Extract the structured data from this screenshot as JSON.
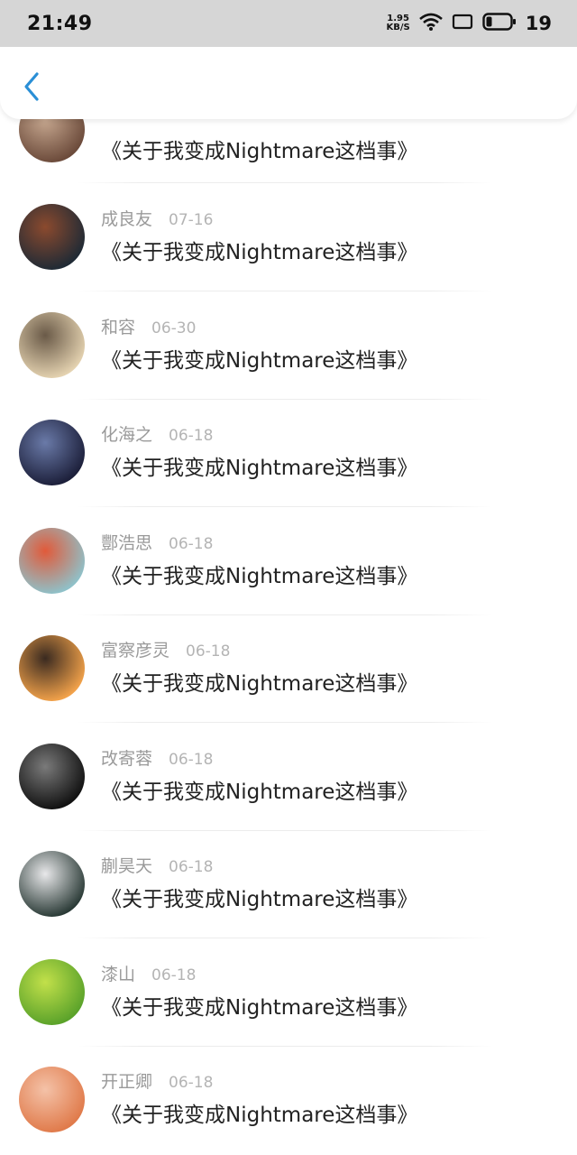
{
  "status_bar": {
    "time": "21:49",
    "net_speed_value": "1.95",
    "net_speed_unit": "KB/S",
    "battery_level": "19",
    "icons": [
      "wifi-icon",
      "screen-icon",
      "battery-icon"
    ]
  },
  "nav": {
    "back_icon": "chevron-left-icon",
    "accent": "#2a8fd6"
  },
  "items": [
    {
      "name": "",
      "date": "",
      "title": "《关于我变成Nightmare这档事》",
      "avatar_colors": [
        "#6b4a3a",
        "#c7a890"
      ]
    },
    {
      "name": "成良友",
      "date": "07-16",
      "title": "《关于我变成Nightmare这档事》",
      "avatar_colors": [
        "#1f2a35",
        "#8b4a2e"
      ]
    },
    {
      "name": "和容",
      "date": "06-30",
      "title": "《关于我变成Nightmare这档事》",
      "avatar_colors": [
        "#e4d2b0",
        "#6a5a48"
      ]
    },
    {
      "name": "化海之",
      "date": "06-18",
      "title": "《关于我变成Nightmare这档事》",
      "avatar_colors": [
        "#1c1f3a",
        "#6a7aa8"
      ]
    },
    {
      "name": "酆浩思",
      "date": "06-18",
      "title": "《关于我变成Nightmare这档事》",
      "avatar_colors": [
        "#8fc1c9",
        "#e15a3a"
      ]
    },
    {
      "name": "富察彦灵",
      "date": "06-18",
      "title": "《关于我变成Nightmare这档事》",
      "avatar_colors": [
        "#f2a24a",
        "#3a2a20"
      ]
    },
    {
      "name": "改寄蓉",
      "date": "06-18",
      "title": "《关于我变成Nightmare这档事》",
      "avatar_colors": [
        "#111111",
        "#7a7a7a"
      ]
    },
    {
      "name": "蒯昊天",
      "date": "06-18",
      "title": "《关于我变成Nightmare这档事》",
      "avatar_colors": [
        "#2a3a36",
        "#e8e8ea"
      ]
    },
    {
      "name": "漆山",
      "date": "06-18",
      "title": "《关于我变成Nightmare这档事》",
      "avatar_colors": [
        "#5aa22a",
        "#c2e04a"
      ]
    },
    {
      "name": "开正卿",
      "date": "06-18",
      "title": "《关于我变成Nightmare这档事》",
      "avatar_colors": [
        "#e07a4a",
        "#f4c2a8"
      ]
    }
  ]
}
